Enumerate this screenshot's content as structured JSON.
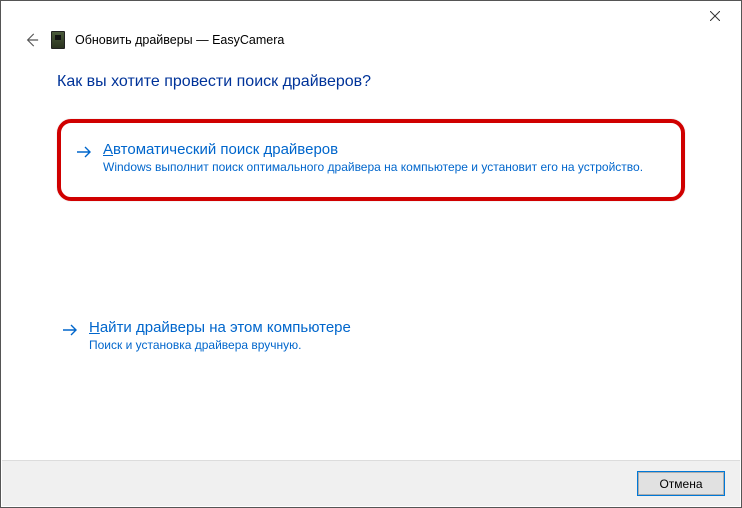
{
  "header": {
    "title": "Обновить драйверы — EasyCamera"
  },
  "question": "Как вы хотите провести поиск драйверов?",
  "options": {
    "auto": {
      "title": "Автоматический поиск драйверов",
      "desc": "Windows выполнит поиск оптимального драйвера на компьютере и установит его на устройство."
    },
    "manual": {
      "title": "Найти драйверы на этом компьютере",
      "desc": "Поиск и установка драйвера вручную."
    }
  },
  "footer": {
    "cancel": "Отмена"
  }
}
